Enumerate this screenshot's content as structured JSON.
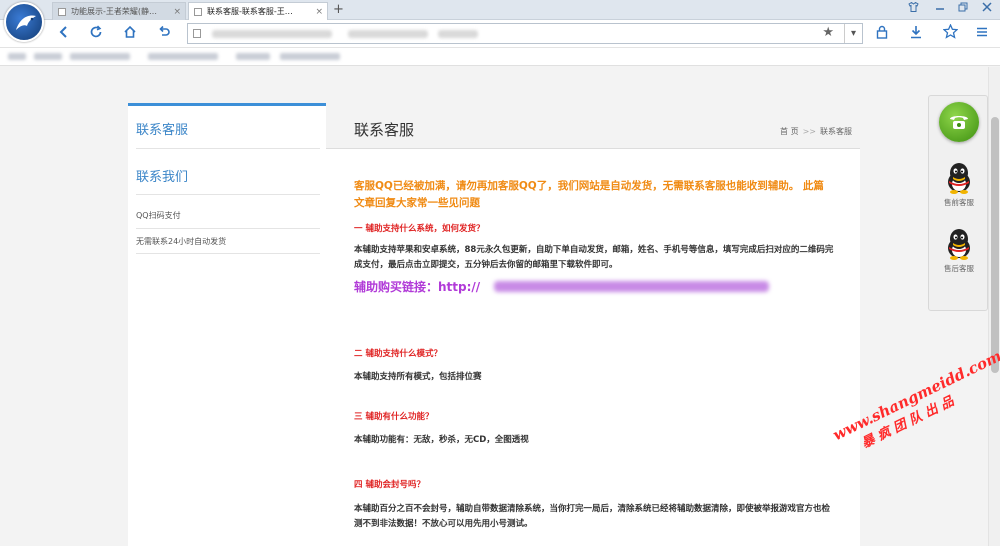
{
  "browser": {
    "tabs": [
      {
        "label": "功能展示-王者荣耀(静…",
        "active": false
      },
      {
        "label": "联系客服-联系客服-王…",
        "active": true
      }
    ],
    "new_tab_glyph": "+",
    "close_glyph": "×",
    "window_controls": [
      "shirt-icon",
      "minimize-icon",
      "restore-icon",
      "close-icon"
    ],
    "nav_icons": [
      "back-icon",
      "refresh-icon",
      "home-icon",
      "undo-icon"
    ],
    "right_icons": [
      "lock-icon",
      "download-icon",
      "star-icon",
      "menu-icon"
    ]
  },
  "sidebar": {
    "heading": "联系客服",
    "items": [
      {
        "label": "联系我们"
      },
      {
        "label": "QQ扫码支付"
      },
      {
        "label": "无需联系24小时自动发货"
      }
    ]
  },
  "content": {
    "title": "联系客服",
    "breadcrumb": {
      "home": "首 页",
      "separator": ">>",
      "current": "联系客服"
    },
    "intro": "客服QQ已经被加满，请勿再加客服QQ了，我们网站是自动发货，无需联系客服也能收到辅助。 此篇文章回复大家常一些见问题",
    "faq": [
      {
        "q": "一 辅助支持什么系统，如何发货？",
        "a": "本辅助支持苹果和安卓系统，88元永久包更新，自助下单自动发货，邮箱，姓名、手机号等信息，填写完成后扫对应的二维码完成支付，最后点击立即提交，五分钟后去你留的邮箱里下载软件即可。"
      },
      {
        "q": "二 辅助支持什么模式？",
        "a": "本辅助支持所有模式，包括排位赛"
      },
      {
        "q": "三 辅助有什么功能？",
        "a": "本辅助功能有：无敌，秒杀，无CD，全图透视"
      },
      {
        "q": "四 辅助会封号吗？",
        "a": "本辅助百分之百不会封号，辅助自带数据清除系统，当你打完一局后，清除系统已经将辅助数据清除，即使被举报游戏官方也检测不到非法数据！不放心可以用先用小号测试。"
      }
    ],
    "buy_link_label": "辅助购买链接：http://"
  },
  "service_panel": {
    "items": [
      {
        "icon": "phone-icon",
        "label": ""
      },
      {
        "icon": "qq-icon",
        "label": "售前客服"
      },
      {
        "icon": "qq-icon",
        "label": "售后客服"
      }
    ]
  },
  "watermark": {
    "line1": "www.shangmeidd.com",
    "line2": "暴 疯 团 队 出 品"
  },
  "colors": {
    "accent": "#3c8fd8",
    "intro": "#f08b14",
    "question": "#e02424",
    "link": "#b13bd8",
    "watermark": "#ff2a2a"
  }
}
